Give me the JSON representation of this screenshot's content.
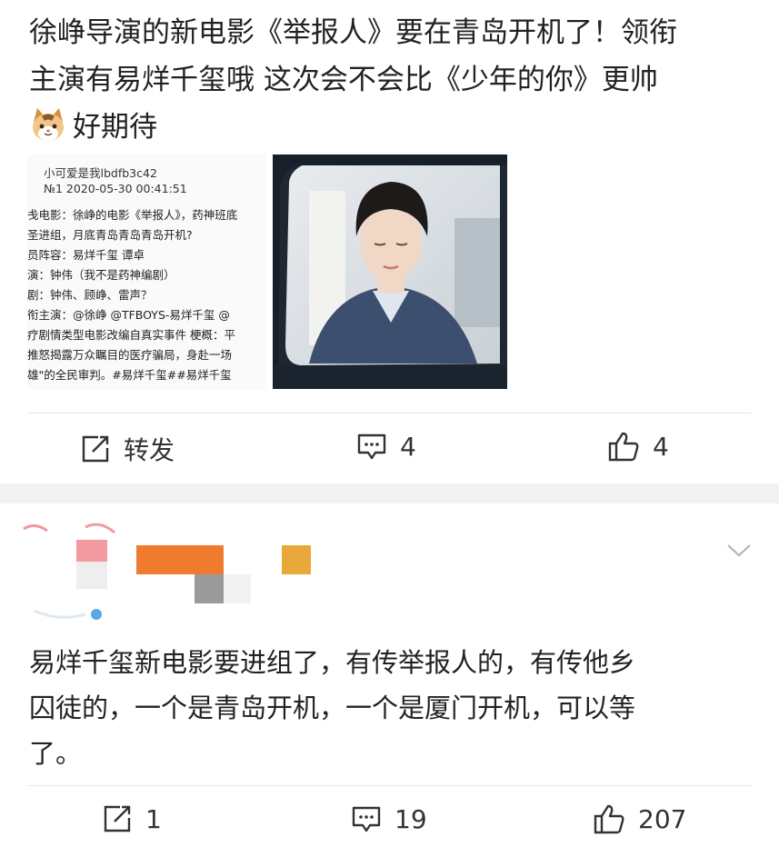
{
  "post": {
    "text_lines": [
      "徐峥导演的新电影《举报人》要在青岛开机了！领衔",
      "主演有易烊千玺哦 这次会不会比《少年的你》更帅",
      "好期待"
    ],
    "emoji": "cat-face-icon",
    "screenshot": {
      "username": "小可爱是我lbdfb3c42",
      "meta": "№1  2020-05-30 00:41:51",
      "lines": [
        "戋电影：徐峥的电影《举报人》，药神班底",
        "圣进组，月底青岛青岛青岛开机?",
        "员阵容：易烊千玺 谭卓",
        "演：钟伟（我不是药神编剧）",
        "剧：钟伟、顾峥、雷声？",
        "衔主演：@徐峥 @TFBOYS-易烊千玺 @",
        "疗剧情类型电影改编自真实事件  梗概：平",
        "推怒揭露万众瞩目的医疗骗局，身赴一场",
        "雄\"的全民审判。#易烊千玺##易烊千玺"
      ]
    },
    "actions": {
      "repost_label": "转发",
      "comment_count": "4",
      "like_count": "4"
    }
  },
  "comment": {
    "text_lines": [
      "易烊千玺新电影要进组了，有传举报人的，有传他乡",
      "囚徒的，一个是青岛开机，一个是厦门开机，可以等",
      "了。"
    ],
    "actions": {
      "repost_count": "1",
      "comment_count": "19",
      "like_count": "207"
    }
  },
  "colors": {
    "mosaic_orange": "#f07b2e",
    "mosaic_yellow": "#e9a93a",
    "mosaic_pink": "#f29a9f",
    "mosaic_gray": "#9a9a9a",
    "separator": "#f2f2f2"
  }
}
